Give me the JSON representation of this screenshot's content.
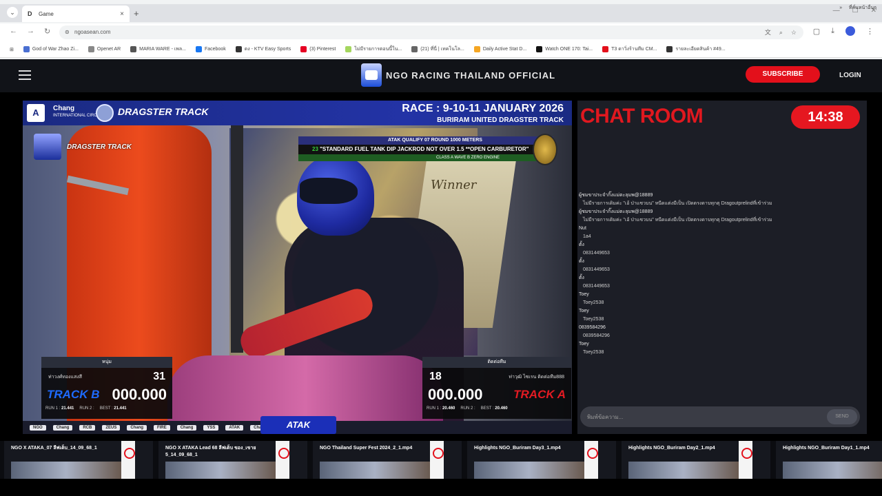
{
  "browser": {
    "tab_title": "Game",
    "tab_favicon": "D",
    "tab_close": "×",
    "new_tab": "+",
    "url": "ngoasean.com",
    "bookmarks": [
      {
        "label": "God of War Zhao Zi...",
        "color": "#4a6fd1"
      },
      {
        "label": "Openet AR",
        "color": "#888888"
      },
      {
        "label": "MARIA WARE - เพล...",
        "color": "#555555"
      },
      {
        "label": "Facebook",
        "color": "#1877f2"
      },
      {
        "label": "ดง - KTV Easy Sports",
        "color": "#333333"
      },
      {
        "label": "(3) Pinterest",
        "color": "#e60023"
      },
      {
        "label": "ไม่มีรายการตอนนี้ใน...",
        "color": "#a4d65e"
      },
      {
        "label": "(21) ที่นี่ | เทคโนโล...",
        "color": "#666666"
      },
      {
        "label": "Daily Active Stat D...",
        "color": "#f5a623"
      },
      {
        "label": "Watch ONE 170: Tai...",
        "color": "#111111"
      },
      {
        "label": "T3 ดาวิ่งร้านทีม CM...",
        "color": "#e3101b"
      },
      {
        "label": "รายละเอียดสินค้า #49...",
        "color": "#333333"
      }
    ],
    "bookmarks_more": "»",
    "bookmarks_folder": "ที่คั่นหน้าอื่นๆ"
  },
  "header": {
    "site_title": "NGO RACING THAILAND OFFICIAL",
    "subscribe_label": "SUBSCRIBE",
    "login_label": "LOGIN"
  },
  "video": {
    "sponsor": "Chang",
    "sponsor_sub": "INTERNATIONAL CIRCUIT",
    "dragster_logo": "DRAGSTER TRACK",
    "race_title": "RACE : 9-10-11 JANUARY 2026",
    "race_venue": "BURIRAM UNITED DRAGSTER TRACK",
    "banner_top": "ATAK  QUALIFY 07 ROUND  1000 METERS",
    "banner_class_number": "23",
    "banner_class": "\"STANDARD FUEL TANK DIP JACKROD NOT OVER 1.5 **OPEN CARBURETOR\"",
    "banner_bottom": "CLASS A WAVE B ZERO ENGINE",
    "winner_text": "Winner",
    "left": {
      "team": "หนุ่ม",
      "rider": "ท่าวงศ์ทองแสงสี",
      "number": "31",
      "track": "TRACK B",
      "time": "000.000",
      "run1_label": "RUN 1 :",
      "run1": "21.441",
      "run2_label": "RUN 2 :",
      "run2": "",
      "best_label": "BEST :",
      "best": "21.441"
    },
    "right": {
      "team": "ติดต่อทีม",
      "rider": "ท่าวุฒิ ไซเรน ติดต่อทีม888",
      "number": "18",
      "track": "TRACK A",
      "time": "000.000",
      "run1_label": "RUN 1 :",
      "run1": "20.460",
      "run2_label": "RUN 2 :",
      "run2": "",
      "best_label": "BEST :",
      "best": "20.460"
    },
    "bottom_sponsors": [
      "NGO",
      "Chang",
      "RCB",
      "ZEUS",
      "Chang",
      "FIRE",
      "Chang",
      "YSS",
      "ATAK",
      "Chang"
    ],
    "atak_logo": "ATAK"
  },
  "chat": {
    "title": "CHAT ROOM",
    "timer": "14:38",
    "messages": [
      {
        "user": "ผู้ชมขาประจำกิ๊งแม่ตะลุมพ@18889",
        "text": "ไม่มีรายการเดิมค่ะ \"เอ้ ป่าแซวบน\" หนีดแต่งมีเป็น เปิดตรงดาบทุกตุ Dragoutprelindที่เข้าร่วม"
      },
      {
        "user": "ผู้ชมขาประจำกิ๊งแม่ตะลุมพ@18889",
        "text": "ไม่มีรายการเดิมค่ะ \"เอ้ ป่าแซวบน\" หนีดแต่งมีเป็น เปิดตรงดาบทุกตุ Dragoutprelindที่เข้าร่วม"
      },
      {
        "user": "Nut",
        "text": "1a4"
      },
      {
        "user": "ตั้ง",
        "text": "0831449653"
      },
      {
        "user": "ตั้ง",
        "text": "0831449653"
      },
      {
        "user": "ตั้ง",
        "text": "0831449653"
      },
      {
        "user": "Toey",
        "text": "Toey2538"
      },
      {
        "user": "Toey",
        "text": "Toey2538"
      },
      {
        "user": "0839584296",
        "text": "0839584296"
      },
      {
        "user": "Toey",
        "text": "Toey2538"
      }
    ],
    "input_placeholder": "พิมพ์ข้อความ...",
    "send_label": "SEND"
  },
  "videos": [
    {
      "title": "NGO X ATAKA_07 ลีฟเต็บ_14_09_68_1"
    },
    {
      "title": "NGO X ATAKA Lead 68 ลีฟเต็บ ของ_เขาย 5_14_09_68_1"
    },
    {
      "title": "NGO Thailand Super Fest 2024_2_1.mp4"
    },
    {
      "title": "Highlights NGO_Buriram Day3_1.mp4"
    },
    {
      "title": "Highlights NGO_Buriram Day2_1.mp4"
    },
    {
      "title": "Highlights NGO_Buriram Day1_1.mp4"
    }
  ]
}
